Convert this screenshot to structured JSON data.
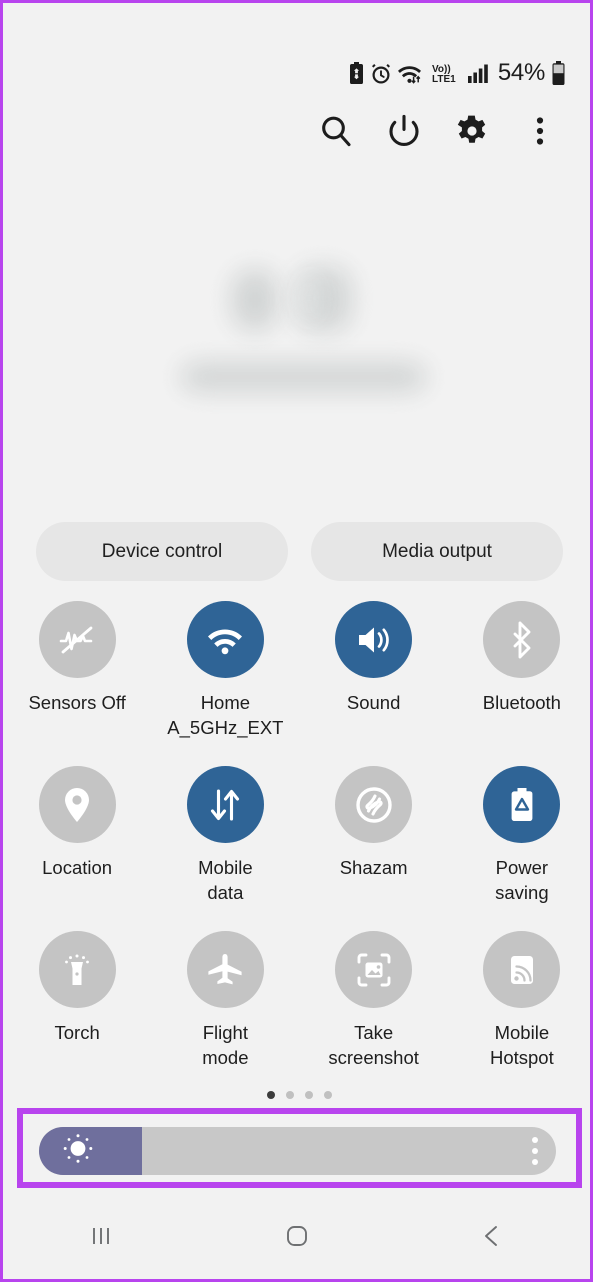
{
  "device": {
    "platform": "Android",
    "screen": "quick-settings-panel",
    "background_color": "#f2f2f2",
    "highlight_color": "#b844ee"
  },
  "status_bar": {
    "battery_percent_label": "54%",
    "icons": [
      "battery-saver-icon",
      "alarm-icon",
      "wifi-data-transfer-icon",
      "volte-lte-icon",
      "signal-bars-icon",
      "battery-icon"
    ]
  },
  "toolbar": {
    "buttons": [
      {
        "name": "search-icon",
        "label": "Search"
      },
      {
        "name": "power-icon",
        "label": "Power off"
      },
      {
        "name": "gear-icon",
        "label": "Settings"
      },
      {
        "name": "more-options-icon",
        "label": "More options"
      }
    ]
  },
  "pills": [
    {
      "label": "Device control"
    },
    {
      "label": "Media output"
    }
  ],
  "quick_settings": {
    "accent_on_color": "#2f6496",
    "accent_off_color": "#c4c4c4",
    "tiles": [
      {
        "label": "Sensors Off",
        "icon": "sensors-off-icon",
        "state": "off"
      },
      {
        "label": "Home\nA_5GHz_EXT",
        "icon": "wifi-icon",
        "state": "on"
      },
      {
        "label": "Sound",
        "icon": "volume-sound-icon",
        "state": "on"
      },
      {
        "label": "Bluetooth",
        "icon": "bluetooth-icon",
        "state": "off"
      },
      {
        "label": "Location",
        "icon": "location-pin-icon",
        "state": "off"
      },
      {
        "label": "Mobile\ndata",
        "icon": "mobile-data-icon",
        "state": "on"
      },
      {
        "label": "Shazam",
        "icon": "shazam-icon",
        "state": "off"
      },
      {
        "label": "Power\nsaving",
        "icon": "power-saving-icon",
        "state": "on"
      },
      {
        "label": "Torch",
        "icon": "flashlight-icon",
        "state": "off"
      },
      {
        "label": "Flight\nmode",
        "icon": "airplane-icon",
        "state": "off"
      },
      {
        "label": "Take\nscreenshot",
        "icon": "screenshot-icon",
        "state": "off"
      },
      {
        "label": "Mobile\nHotspot",
        "icon": "hotspot-icon",
        "state": "off"
      }
    ]
  },
  "page_indicator": {
    "total_pages": 4,
    "active_page": 1
  },
  "brightness_slider": {
    "name": "brightness-slider",
    "level_percent": 20,
    "fill_color": "#6f6f9d",
    "track_color": "#c8c8c8",
    "thumb_icon": "brightness-sun-icon",
    "menu_icon": "more-options-icon",
    "highlighted": true
  },
  "navigation_bar": {
    "buttons": [
      {
        "label": "Recents",
        "icon": "recents-icon"
      },
      {
        "label": "Home",
        "icon": "home-icon"
      },
      {
        "label": "Back",
        "icon": "back-chevron-icon"
      }
    ]
  }
}
